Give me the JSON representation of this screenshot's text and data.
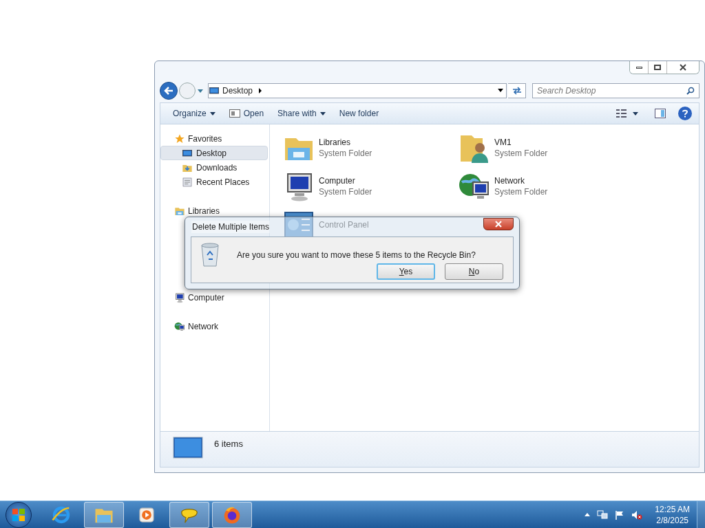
{
  "window": {
    "address": {
      "location": "Desktop"
    },
    "search": {
      "placeholder": "Search Desktop"
    },
    "toolbar": [
      {
        "label": "Organize",
        "kind": "menu"
      },
      {
        "label": "Open",
        "kind": "open"
      },
      {
        "label": "Share with",
        "kind": "menu"
      },
      {
        "label": "New folder",
        "kind": "plain"
      }
    ],
    "sidebar": [
      {
        "label": "Favorites",
        "kind": "star",
        "children": [
          {
            "label": "Desktop",
            "kind": "desktop",
            "selected": true
          },
          {
            "label": "Downloads",
            "kind": "downloads",
            "selected": false
          },
          {
            "label": "Recent Places",
            "kind": "recent",
            "selected": false
          }
        ]
      },
      {
        "label": "Libraries",
        "kind": "libraries"
      },
      {
        "label": "Computer",
        "kind": "computer"
      },
      {
        "label": "Network",
        "kind": "network"
      }
    ],
    "items": [
      {
        "name": "Libraries",
        "type": "System Folder",
        "kind": "libraries"
      },
      {
        "name": "VM1",
        "type": "System Folder",
        "kind": "user"
      },
      {
        "name": "Computer",
        "type": "System Folder",
        "kind": "computer"
      },
      {
        "name": "Network",
        "type": "System Folder",
        "kind": "network"
      },
      {
        "name": "Control Panel",
        "kind": "control-panel"
      }
    ],
    "status": "6 items"
  },
  "dialog": {
    "title": "Delete Multiple Items",
    "message": "Are you sure you want to move these 5 items to the Recycle Bin?",
    "buttons": [
      {
        "label": "Yes",
        "default": true
      },
      {
        "label": "No",
        "default": false
      }
    ]
  },
  "taskbar": {
    "apps": [
      {
        "kind": "ie",
        "running": false
      },
      {
        "kind": "explorer",
        "running": true
      },
      {
        "kind": "media",
        "running": false
      },
      {
        "kind": "chat",
        "running": true
      },
      {
        "kind": "firefox",
        "running": true
      }
    ],
    "time": "12:25 AM",
    "date": "2/8/2025"
  }
}
